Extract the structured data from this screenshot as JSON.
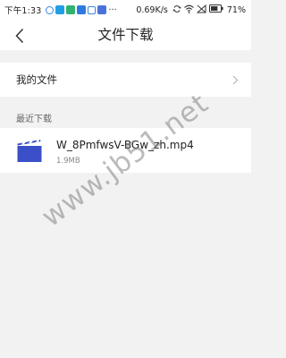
{
  "status_bar": {
    "time": "下午1:33",
    "notification_icons": [
      {
        "name": "circle-app-icon",
        "color": "#2b8ae6"
      },
      {
        "name": "shield-app-icon",
        "color": "#1f9ee6"
      },
      {
        "name": "green-app-icon",
        "color": "#2fb36e"
      },
      {
        "name": "blue-app-icon",
        "color": "#2d7be0"
      },
      {
        "name": "square-app-icon",
        "color": "#3d85d8"
      },
      {
        "name": "video-app-icon",
        "color": "#4a73d9"
      }
    ],
    "more_indicator": "···",
    "net_speed": "0.69K/s",
    "battery_percent": "71%"
  },
  "nav": {
    "title": "文件下载"
  },
  "my_files": {
    "label": "我的文件"
  },
  "recent": {
    "header": "最近下载",
    "items": [
      {
        "name": "W_8PmfwsV-BGw_zh.mp4",
        "size": "1.9MB",
        "icon": "video-file-icon"
      }
    ]
  },
  "watermark": "www.jb51.net",
  "colors": {
    "background": "#f2f2f2",
    "file_icon": "#3b50c8"
  }
}
